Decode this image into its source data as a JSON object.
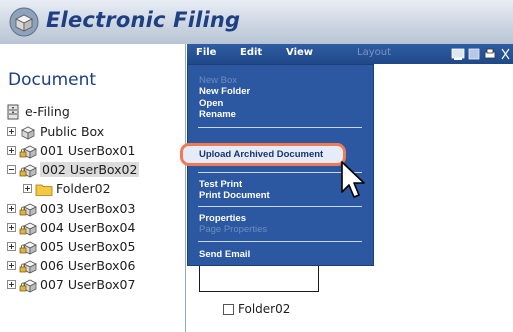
{
  "app": {
    "title": "Electronic Filing"
  },
  "left_panel": {
    "heading": "Document",
    "tree": [
      {
        "label": "e-Filing",
        "icon": "cabinet-icon",
        "expander": "none",
        "level": 0,
        "selected": false
      },
      {
        "label": "Public Box",
        "icon": "public-box-icon",
        "expander": "plus",
        "level": 1,
        "selected": false
      },
      {
        "label": "001 UserBox01",
        "icon": "locked-box-icon",
        "expander": "plus",
        "level": 1,
        "selected": false
      },
      {
        "label": "002 UserBox02",
        "icon": "locked-box-icon",
        "expander": "minus",
        "level": 1,
        "selected": true
      },
      {
        "label": "Folder02",
        "icon": "folder-icon",
        "expander": "plus",
        "level": 2,
        "selected": false
      },
      {
        "label": "003 UserBox03",
        "icon": "locked-box-icon",
        "expander": "plus",
        "level": 1,
        "selected": false
      },
      {
        "label": "004 UserBox04",
        "icon": "locked-box-icon",
        "expander": "plus",
        "level": 1,
        "selected": false
      },
      {
        "label": "005 UserBox05",
        "icon": "locked-box-icon",
        "expander": "plus",
        "level": 1,
        "selected": false
      },
      {
        "label": "006 UserBox06",
        "icon": "locked-box-icon",
        "expander": "plus",
        "level": 1,
        "selected": false
      },
      {
        "label": "007 UserBox07",
        "icon": "locked-box-icon",
        "expander": "plus",
        "level": 1,
        "selected": false
      }
    ]
  },
  "menubar": {
    "file": "File",
    "edit": "Edit",
    "view": "View",
    "layout": "Layout"
  },
  "file_menu": {
    "new_box": "New Box",
    "new_folder": "New Folder",
    "open": "Open",
    "rename": "Rename",
    "upload_archived": "Upload Archived Document",
    "test_print": "Test Print",
    "print_document": "Print Document",
    "properties": "Properties",
    "page_properties": "Page Properties",
    "send_email": "Send Email"
  },
  "content": {
    "folder_label": "Folder02"
  },
  "colors": {
    "title": "#1f3f83",
    "menu_bg": "#2b58a0",
    "highlight_border": "#f07a55"
  }
}
